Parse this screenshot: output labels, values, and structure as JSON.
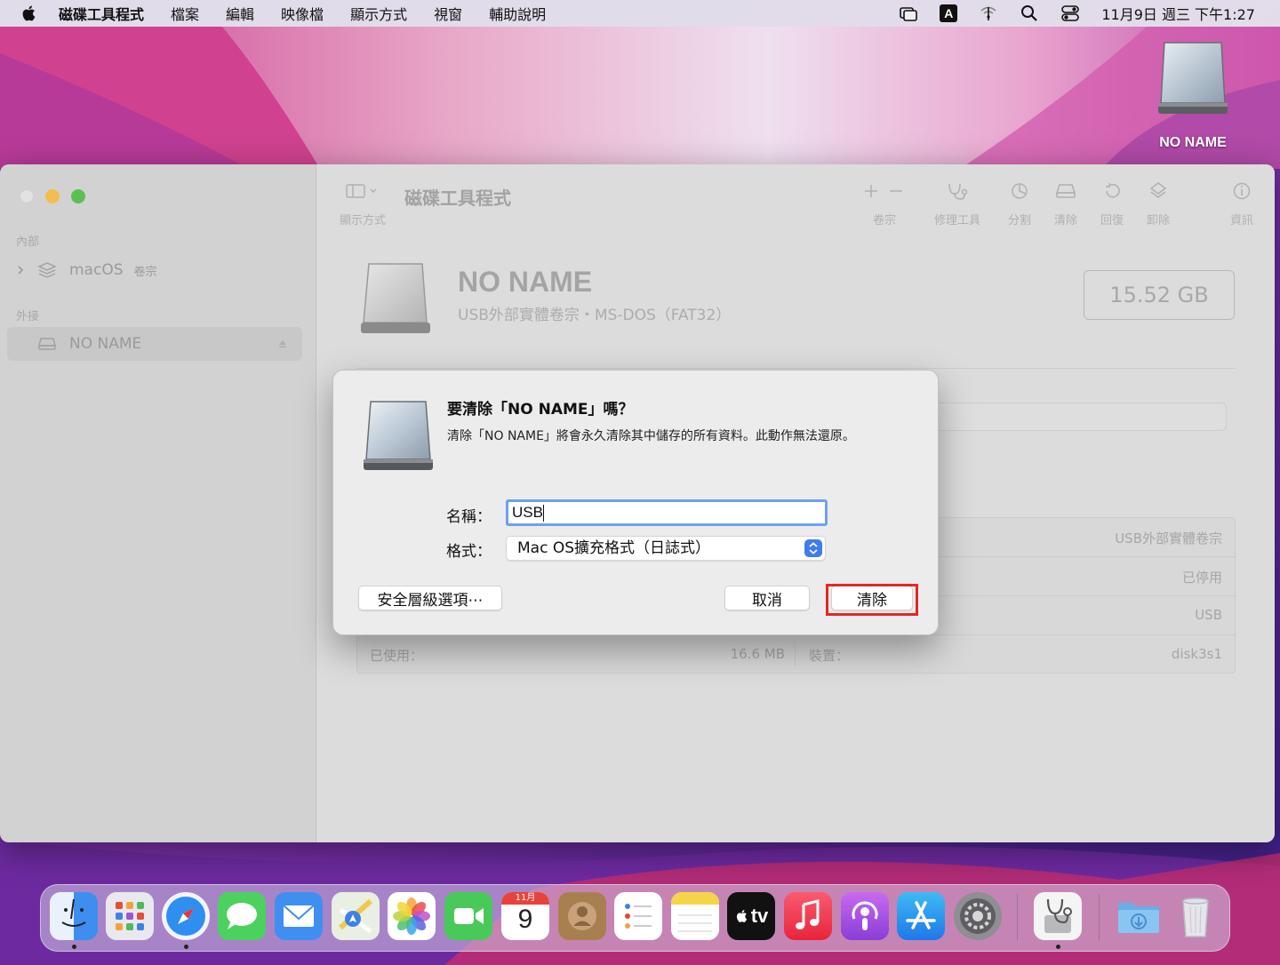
{
  "menubar": {
    "app_name": "磁碟工具程式",
    "items": [
      "檔案",
      "編輯",
      "映像檔",
      "顯示方式",
      "視窗",
      "輔助說明"
    ],
    "input_method": "A",
    "clock": "11月9日 週三 下午1:27"
  },
  "desktop": {
    "drive_label": "NO NAME"
  },
  "window": {
    "title": "磁碟工具程式",
    "sidebar": {
      "section_internal": "內部",
      "internal_item": {
        "name": "macOS",
        "tag": "卷宗"
      },
      "section_external": "外接",
      "external_item": {
        "name": "NO NAME"
      }
    },
    "toolbar": {
      "view": "顯示方式",
      "volume": "卷宗",
      "first_aid": "修理工具",
      "partition": "分割",
      "erase": "清除",
      "restore": "回復",
      "unmount": "卸除",
      "info": "資訊"
    },
    "volume": {
      "name": "NO NAME",
      "subtitle": "USB外部實體卷宗・MS-DOS（FAT32）",
      "size": "15.52 GB"
    },
    "info_table": {
      "row1_right_value": "USB外部實體卷宗",
      "row2_right_value": "已停用",
      "row3_right_value": "USB",
      "row4": {
        "used_label": "已使用：",
        "used_value": "16.6 MB",
        "device_label": "裝置：",
        "device_value": "disk3s1"
      }
    }
  },
  "dialog": {
    "title": "要清除「NO NAME」嗎？",
    "message": "清除「NO NAME」將會永久清除其中儲存的所有資料。此動作無法還原。",
    "name_label": "名稱：",
    "name_value": "USB",
    "format_label": "格式：",
    "format_value": "Mac OS擴充格式（日誌式）",
    "security_button": "安全層級選項⋯",
    "cancel_button": "取消",
    "erase_button": "清除",
    "highlight_color": "#e42626"
  },
  "dock": {
    "calendar_month": "11月",
    "calendar_day": "9",
    "tv_label": "tv"
  }
}
